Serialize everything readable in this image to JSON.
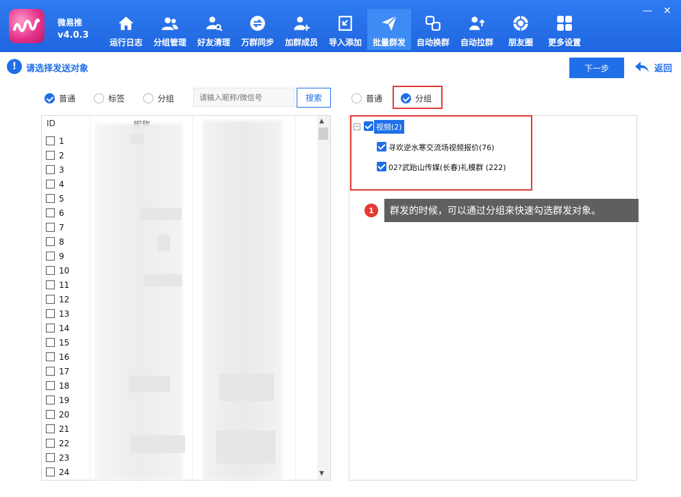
{
  "app": {
    "name": "微易推",
    "version": "v4.0.3"
  },
  "nav": [
    {
      "label": "运行日志",
      "icon": "home-icon"
    },
    {
      "label": "分组管理",
      "icon": "users-icon"
    },
    {
      "label": "好友清理",
      "icon": "user-search-icon"
    },
    {
      "label": "万群同步",
      "icon": "sync-icon"
    },
    {
      "label": "加群成员",
      "icon": "user-add-icon"
    },
    {
      "label": "导入添加",
      "icon": "import-icon"
    },
    {
      "label": "批量群发",
      "icon": "send-icon",
      "active": true
    },
    {
      "label": "自动换群",
      "icon": "swap-icon"
    },
    {
      "label": "自动拉群",
      "icon": "pull-group-icon"
    },
    {
      "label": "朋友圈",
      "icon": "moments-icon"
    },
    {
      "label": "更多设置",
      "icon": "grid-icon"
    }
  ],
  "topbar": {
    "title": "请选择发送对象",
    "next_label": "下一步",
    "back_label": "返回"
  },
  "filter": {
    "radio_normal": "普通",
    "radio_tag": "标签",
    "radio_group": "分组",
    "search_placeholder": "请输入昵称/微信号",
    "search_label": "搜索"
  },
  "right_filter": {
    "radio_normal": "普通",
    "radio_group": "分组"
  },
  "table": {
    "headers": {
      "id": "ID",
      "nickname": "昵称"
    },
    "rows": [
      "1",
      "2",
      "3",
      "4",
      "5",
      "6",
      "7",
      "8",
      "9",
      "10",
      "11",
      "12",
      "13",
      "14",
      "15",
      "16",
      "17",
      "18",
      "19",
      "20",
      "21",
      "22",
      "23",
      "24"
    ]
  },
  "tree": {
    "root": "视频(2)",
    "children": [
      "寻欢逆水寒交流场视频报价(76)",
      "02?武跆山传媒(长春)礼模群 (222)"
    ]
  },
  "tooltip": {
    "number": "1",
    "text": "群发的时候，可以通过分组来快速勾选群发对象。"
  },
  "colors": {
    "primary": "#1f6fe8",
    "header": "#2670ea",
    "highlight": "#e53935"
  }
}
